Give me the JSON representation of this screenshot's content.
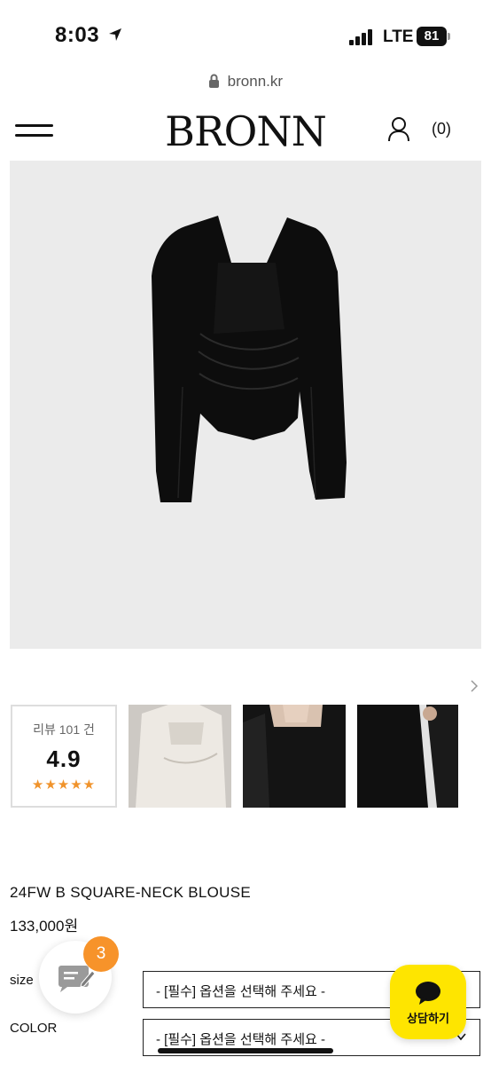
{
  "status_bar": {
    "time": "8:03",
    "network": "LTE",
    "battery": "81"
  },
  "browser": {
    "url": "bronn.kr"
  },
  "header": {
    "brand": "BRONN",
    "cart_count": "(0)"
  },
  "review_summary": {
    "count_label": "리뷰 101 건",
    "score": "4.9",
    "stars": "★★★★★",
    "rating": 4.9
  },
  "product": {
    "name": "24FW B SQUARE-NECK BLOUSE",
    "price": "133,000원"
  },
  "options": [
    {
      "label": "size",
      "placeholder": "- [필수] 옵션을 선택해 주세요 -"
    },
    {
      "label": "COLOR",
      "placeholder": "- [필수] 옵션을 선택해 주세요 -"
    }
  ],
  "chat_widget": {
    "badge_count": "3"
  },
  "kakao": {
    "label": "상담하기"
  },
  "colors": {
    "accent_orange": "#f7932a",
    "kakao_yellow": "#fee500",
    "star_color": "#f0932b"
  }
}
